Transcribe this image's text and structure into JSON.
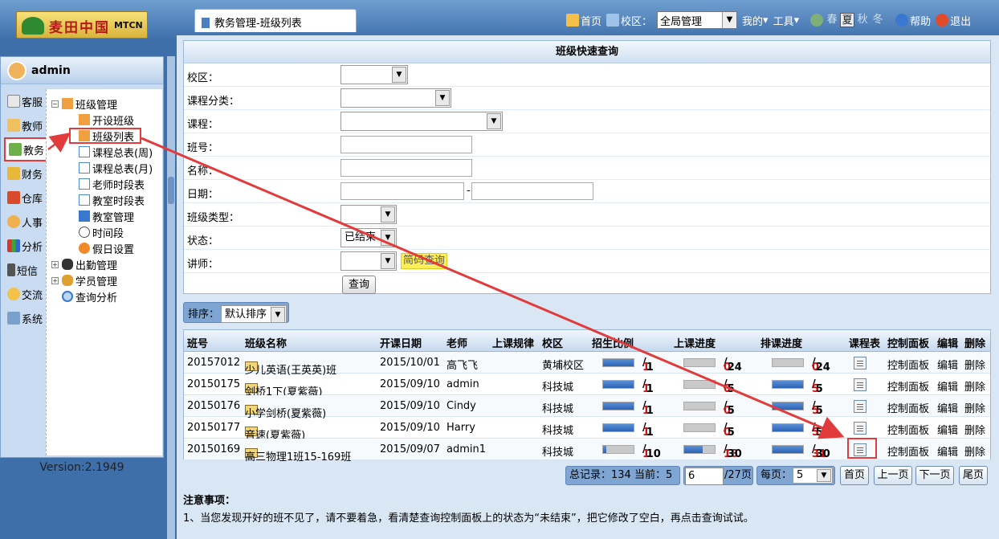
{
  "logo": {
    "cn": "麦田中国",
    "en": "MTCN"
  },
  "tab": {
    "title": "教务管理-班级列表"
  },
  "topnav": {
    "home": "首页",
    "campus_label": "校区：",
    "campus_value": "全局管理",
    "mine": "我的",
    "tools": "工具",
    "seasons": [
      "春",
      "夏",
      "秋",
      "冬"
    ],
    "active_season": "夏",
    "help": "帮助",
    "logout": "退出"
  },
  "user": {
    "name": "admin"
  },
  "modules": [
    "客服",
    "教师",
    "教务",
    "财务",
    "仓库",
    "人事",
    "分析",
    "短信",
    "交流",
    "系统"
  ],
  "active_module": "教务",
  "tree": {
    "class_mgmt": "班级管理",
    "children": [
      "开设班级",
      "班级列表",
      "课程总表(周)",
      "课程总表(月)",
      "老师时段表",
      "教室时段表",
      "教室管理",
      "时间段",
      "假日设置"
    ],
    "attendance": "出勤管理",
    "students": "学员管理",
    "query": "查询分析"
  },
  "version": "Version:2.1949",
  "filters": {
    "title": "班级快速查询",
    "campus": "校区：",
    "course_cat": "课程分类：",
    "course": "课程：",
    "class_no": "班号：",
    "name": "名称：",
    "date": "日期：",
    "date_sep": "-",
    "class_type": "班级类型：",
    "status": "状态：",
    "status_value": "已结束",
    "teacher": "讲师：",
    "quick_btn": "简码查询",
    "query_btn": "查询"
  },
  "sort": {
    "label": "排序：",
    "value": "默认排序"
  },
  "table": {
    "headers": [
      "班号",
      "班级名称",
      "开课日期",
      "老师",
      "上课规律",
      "校区",
      "招生比例",
      "上课进度",
      "排课进度",
      "课程表",
      "控制面板",
      "编辑",
      "删除"
    ],
    "rows": [
      {
        "id": "20157012",
        "name": "少儿英语(王英英)班",
        "date": "2015/10/01",
        "teacher": "高飞飞",
        "campus": "黄埔校区",
        "enroll_a": "1",
        "enroll_b": "1",
        "enroll_pct": 1.0,
        "prog_a": "0",
        "prog_b": "24",
        "prog_pct": 0.0,
        "sched_a": "0",
        "sched_b": "24",
        "sched_pct": 0.0,
        "panel": "控制面板",
        "edit": "编辑",
        "del": "删除"
      },
      {
        "id": "20150175",
        "name": "剑桥1下(夏紫薇)",
        "date": "2015/09/10",
        "teacher": "admin",
        "campus": "科技城",
        "enroll_a": "1",
        "enroll_b": "1",
        "enroll_pct": 1.0,
        "prog_a": "0",
        "prog_b": "5",
        "prog_pct": 0.0,
        "sched_a": "5",
        "sched_b": "5",
        "sched_pct": 1.0,
        "panel": "控制面板",
        "edit": "编辑",
        "del": "删除"
      },
      {
        "id": "20150176",
        "name": "小学剑桥(夏紫薇)",
        "date": "2015/09/10",
        "teacher": "Cindy",
        "campus": "科技城",
        "enroll_a": "1",
        "enroll_b": "1",
        "enroll_pct": 1.0,
        "prog_a": "0",
        "prog_b": "5",
        "prog_pct": 0.0,
        "sched_a": "5",
        "sched_b": "5",
        "sched_pct": 1.0,
        "panel": "控制面板",
        "edit": "编辑",
        "del": "删除"
      },
      {
        "id": "20150177",
        "name": "音速(夏紫薇)",
        "date": "2015/09/10",
        "teacher": "Harry",
        "campus": "科技城",
        "enroll_a": "1",
        "enroll_b": "1",
        "enroll_pct": 1.0,
        "prog_a": "0",
        "prog_b": "5",
        "prog_pct": 0.0,
        "sched_a": "5",
        "sched_b": "5",
        "sched_pct": 1.0,
        "panel": "控制面板",
        "edit": "编辑",
        "del": "删除"
      },
      {
        "id": "20150169",
        "name": "高三物理1班15-169班",
        "date": "2015/09/07",
        "teacher": "admin1",
        "campus": "科技城",
        "enroll_a": "1",
        "enroll_b": "10",
        "enroll_pct": 0.1,
        "prog_a": "18",
        "prog_b": "30",
        "prog_pct": 0.6,
        "sched_a": "31",
        "sched_b": "30",
        "sched_pct": 1.0,
        "panel": "控制面板",
        "edit": "编辑",
        "del": "删除"
      }
    ]
  },
  "pager": {
    "summary": "总记录：134 当前：5",
    "page_input": "6",
    "total": "/27页",
    "per_page_label": "每页：",
    "per_page": "5",
    "first": "首页",
    "prev": "上一页",
    "next": "下一页",
    "last": "尾页"
  },
  "notes": {
    "title": "注意事项：",
    "line1": "1、当您发现开好的班不见了，请不要着急，看清楚查询控制面板上的状态为“未结束”，把它修改了空白，再点击查询试试。"
  },
  "colors": {
    "accent": "#2c63b5",
    "highlight": "#e23b3b",
    "value_red": "#d01010"
  }
}
